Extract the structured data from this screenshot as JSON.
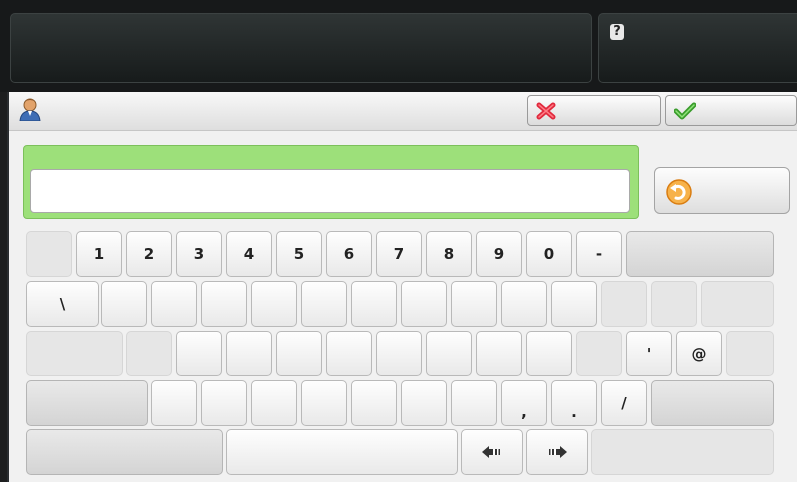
{
  "icons": {
    "help": "help-icon",
    "user": "user-icon",
    "cancel": "close-icon",
    "confirm": "check-icon",
    "undo": "undo-icon",
    "left": "arrow-left-icon",
    "right": "arrow-right-icon"
  },
  "status": {
    "help_glyph": "?"
  },
  "input": {
    "value": "",
    "placeholder": ""
  },
  "colors": {
    "input_frame": "#9de07a",
    "cancel": "#e0283c",
    "confirm": "#4cc43c",
    "undo": "#f39a1e"
  },
  "keyboard": {
    "row1": [
      "",
      "1",
      "2",
      "3",
      "4",
      "5",
      "6",
      "7",
      "8",
      "9",
      "0",
      "-",
      ""
    ],
    "row2": [
      "\\",
      "",
      "",
      "",
      "",
      "",
      "",
      "",
      "",
      "",
      "",
      "",
      ""
    ],
    "row3": [
      "",
      "",
      "",
      "",
      "",
      "",
      "",
      "",
      "",
      "",
      "",
      "'",
      "@",
      ""
    ],
    "row4": [
      "",
      "",
      "",
      "",
      "",
      "",
      "",
      "",
      ",",
      ".",
      "/",
      ""
    ],
    "row5": [
      "",
      "",
      "",
      "",
      ""
    ]
  }
}
